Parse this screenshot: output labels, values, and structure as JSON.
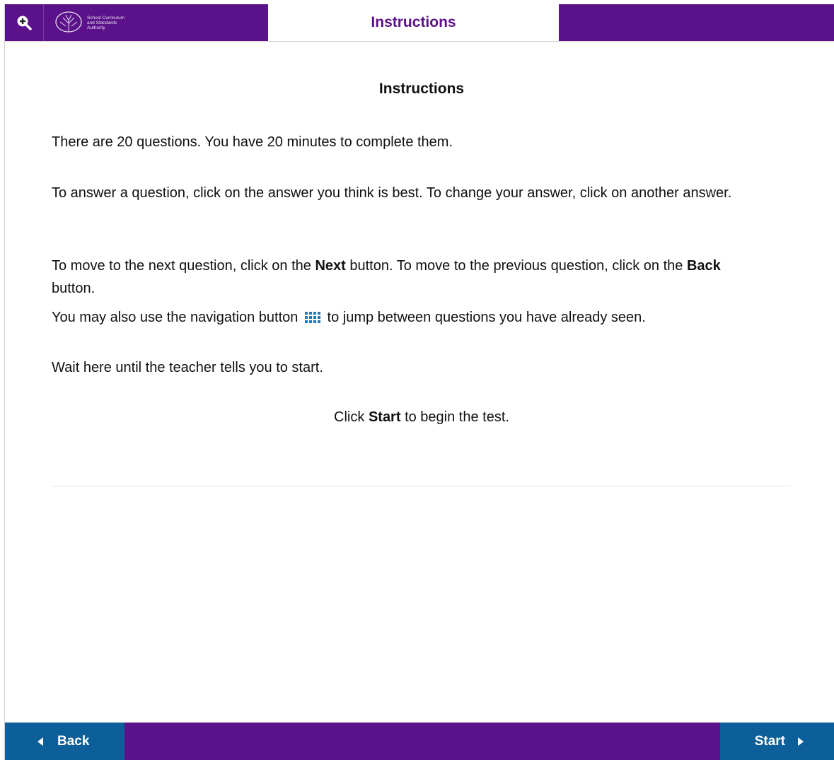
{
  "header": {
    "zoom_icon": "zoom-in-icon",
    "logo": {
      "icon": "tree-emblem-icon",
      "line1": "School Curriculum",
      "line2": "and Standards",
      "line3": "Authority"
    },
    "title": "Instructions"
  },
  "content": {
    "heading": "Instructions",
    "p1": "There are 20 questions. You have 20 minutes to complete them.",
    "p2": "To answer a question, click on the answer you think is best. To change your answer, click on another answer.",
    "p3": {
      "part1": "To move to the next question, click on the ",
      "next": "Next",
      "part2": " button. To move to the previous question, click on the ",
      "back": "Back",
      "part3": " button."
    },
    "p4": {
      "part1": "You may also use the navigation button",
      "icon": "grid-navigation-icon",
      "part2": "to jump between questions you have already seen."
    },
    "p5": "Wait here until the teacher tells you to start.",
    "p6": {
      "part1": "Click ",
      "start": "Start",
      "part2": " to begin the test."
    }
  },
  "footer": {
    "back_label": "Back",
    "start_label": "Start"
  },
  "colors": {
    "brand_purple": "#5a1189",
    "button_blue": "#0d5f9a",
    "nav_icon_blue": "#1a7bbf"
  }
}
